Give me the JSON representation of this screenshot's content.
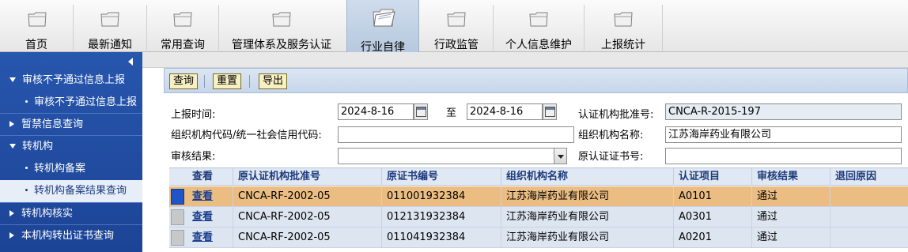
{
  "nav": {
    "items": [
      {
        "label": "首页"
      },
      {
        "label": "最新通知"
      },
      {
        "label": "常用查询"
      },
      {
        "label": "管理体系及服务认证"
      },
      {
        "label": "行业自律"
      },
      {
        "label": "行政监管"
      },
      {
        "label": "个人信息维护"
      },
      {
        "label": "上报统计"
      }
    ],
    "active_index": 4
  },
  "sidebar": {
    "items": [
      {
        "label": "审核不予通过信息上报",
        "type": "group-open"
      },
      {
        "label": "审核不予通过信息上报",
        "type": "sub"
      },
      {
        "label": "暂禁信息查询",
        "type": "group-closed"
      },
      {
        "label": "转机构",
        "type": "group-open"
      },
      {
        "label": "转机构备案",
        "type": "sub"
      },
      {
        "label": "转机构备案结果查询",
        "type": "sub-selected"
      },
      {
        "label": "转机构核实",
        "type": "group-closed"
      },
      {
        "label": "本机构转出证书查询",
        "type": "group-closed"
      }
    ]
  },
  "toolbar": {
    "query_label": "查询",
    "reset_label": "重置",
    "export_label": "导出"
  },
  "form": {
    "report_time_label": "上报时间:",
    "date_from": "2024-8-16",
    "to_label": "至",
    "date_to": "2024-8-16",
    "approval_no_label": "认证机构批准号:",
    "approval_no_value": "CNCA-R-2015-197",
    "org_code_label": "组织机构代码/统一社会信用代码:",
    "org_code_value": "",
    "org_name_label": "组织机构名称:",
    "org_name_value": "江苏海岸药业有限公司",
    "review_result_label": "审核结果:",
    "review_result_value": "",
    "orig_cert_no_label": "原认证证书号:",
    "orig_cert_no_value": ""
  },
  "grid": {
    "columns": [
      "查看",
      "原认证机构批准号",
      "原证书编号",
      "组织机构名称",
      "认证项目",
      "审核结果",
      "退回原因"
    ],
    "rows": [
      {
        "view": "查看",
        "orig_approval": "CNCA-RF-2002-05",
        "cert_no": "011001932384",
        "org_name": "江苏海岸药业有限公司",
        "project": "A0101",
        "result": "通过",
        "reason": "",
        "selected": true
      },
      {
        "view": "查看",
        "orig_approval": "CNCA-RF-2002-05",
        "cert_no": "012131932384",
        "org_name": "江苏海岸药业有限公司",
        "project": "A0301",
        "result": "通过",
        "reason": "",
        "selected": false
      },
      {
        "view": "查看",
        "orig_approval": "CNCA-RF-2002-05",
        "cert_no": "011041932384",
        "org_name": "江苏海岸药业有限公司",
        "project": "A0201",
        "result": "通过",
        "reason": "",
        "selected": false
      }
    ]
  },
  "colors": {
    "sidebar_bg": "#2756ad",
    "selected_row": "#ebbd82",
    "row_bg": "#dde6f0",
    "header_text": "#1d3a7c"
  }
}
